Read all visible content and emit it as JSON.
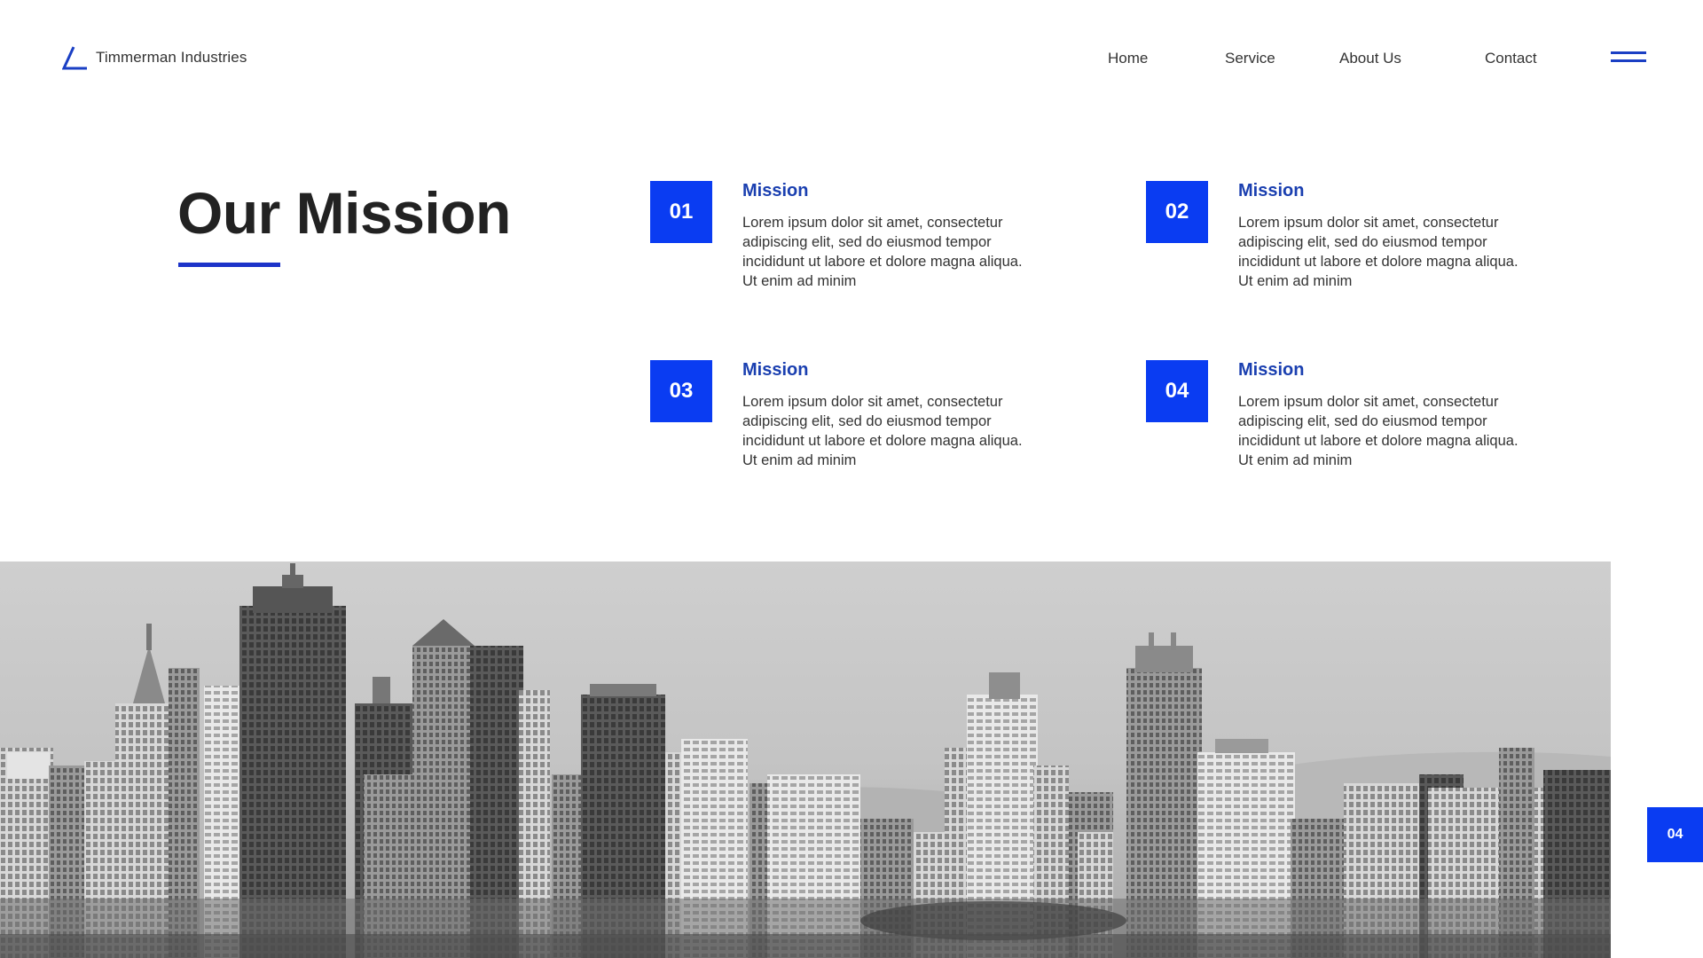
{
  "header": {
    "brand_name": "Timmerman Industries",
    "logo_icon": "triangle-logo-icon",
    "nav": {
      "home": "Home",
      "service": "Service",
      "about": "About Us",
      "contact": "Contact"
    },
    "menu_icon": "hamburger-menu-icon"
  },
  "main": {
    "title": "Our Mission",
    "items": [
      {
        "number": "01",
        "heading": "Mission",
        "text": "Lorem ipsum dolor sit amet, consectetur adipiscing elit, sed do eiusmod tempor incididunt ut labore et dolore magna aliqua. Ut enim ad minim"
      },
      {
        "number": "02",
        "heading": "Mission",
        "text": "Lorem ipsum dolor sit amet, consectetur adipiscing elit, sed do eiusmod tempor incididunt ut labore et dolore magna aliqua. Ut enim ad minim"
      },
      {
        "number": "03",
        "heading": "Mission",
        "text": "Lorem ipsum dolor sit amet, consectetur adipiscing elit, sed do eiusmod tempor incididunt ut labore et dolore magna aliqua. Ut enim ad minim"
      },
      {
        "number": "04",
        "heading": "Mission",
        "text": "Lorem ipsum dolor sit amet, consectetur adipiscing elit, sed do eiusmod tempor incididunt ut labore et dolore magna aliqua. Ut enim ad minim"
      }
    ]
  },
  "page_indicator": "04",
  "colors": {
    "accent": "#0a3cf2",
    "heading_blue": "#1a3fb0",
    "underline": "#1c33c9",
    "text_dark": "#222222"
  }
}
